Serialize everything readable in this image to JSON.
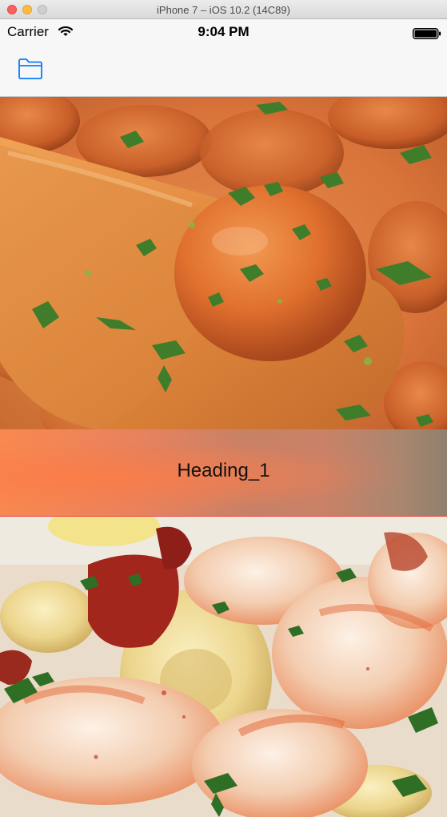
{
  "window": {
    "title": "iPhone 7 – iOS 10.2 (14C89)"
  },
  "status_bar": {
    "carrier": "Carrier",
    "time": "9:04 PM",
    "icons": [
      "wifi-icon",
      "battery-icon"
    ]
  },
  "nav_bar": {
    "left_icon": "folder-icon"
  },
  "content": {
    "images": [
      {
        "subject": "meatball-on-wooden-spoon-photo"
      },
      {
        "subject": "shrimp-tortellini-pasta-photo"
      }
    ],
    "heading": "Heading_1"
  },
  "colors": {
    "ios_blue": "#0a7aff",
    "heading_separator": "#e8413b",
    "window_close": "#fc605c",
    "window_minimize": "#fdbc40"
  }
}
